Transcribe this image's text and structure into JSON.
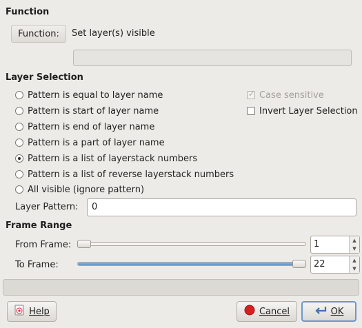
{
  "function_section": {
    "title": "Function",
    "button_label": "Function:",
    "value": "Set layer(s) visible",
    "info_text": ""
  },
  "layer_selection": {
    "title": "Layer Selection",
    "options": [
      {
        "label": "Pattern is equal to layer name",
        "selected": false
      },
      {
        "label": "Pattern is start of layer name",
        "selected": false
      },
      {
        "label": "Pattern is end of layer name",
        "selected": false
      },
      {
        "label": "Pattern is a part of layer name",
        "selected": false
      },
      {
        "label": "Pattern is a list of layerstack numbers",
        "selected": true
      },
      {
        "label": "Pattern is a list of reverse layerstack numbers",
        "selected": false
      },
      {
        "label": "All visible (ignore pattern)",
        "selected": false
      }
    ],
    "case_sensitive": {
      "label": "Case sensitive",
      "checked": true,
      "enabled": false
    },
    "invert_selection": {
      "label": "Invert Layer Selection",
      "checked": false,
      "enabled": true
    },
    "pattern_label": "Layer Pattern:",
    "pattern_value": "0"
  },
  "frame_range": {
    "title": "Frame Range",
    "from_label": "From Frame:",
    "from_value": "1",
    "to_label": "To Frame:",
    "to_value": "22"
  },
  "status_text": "",
  "buttons": {
    "help_label": "Help",
    "cancel_label": "Cancel",
    "ok_label": "OK"
  },
  "colors": {
    "background": "#edebe7",
    "accent": "#5a93cf",
    "cancel_icon": "#d42020"
  },
  "icons": {
    "help": "help-book-icon",
    "cancel": "cancel-red-circle-icon",
    "ok": "ok-arrow-icon"
  }
}
